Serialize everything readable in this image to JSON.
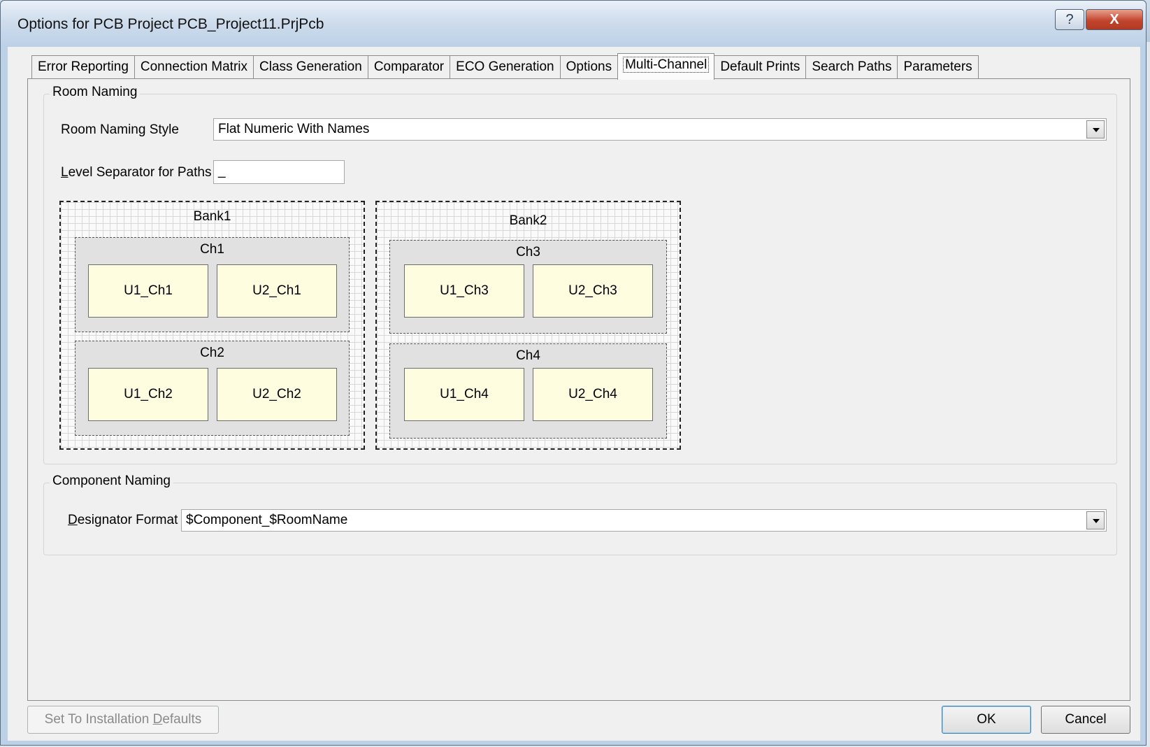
{
  "window": {
    "title": "Options for PCB Project PCB_Project11.PrjPcb",
    "help_glyph": "?",
    "close_glyph": "X"
  },
  "tabs": [
    {
      "label": "Error Reporting"
    },
    {
      "label": "Connection Matrix"
    },
    {
      "label": "Class Generation"
    },
    {
      "label": "Comparator"
    },
    {
      "label": "ECO Generation"
    },
    {
      "label": "Options"
    },
    {
      "label": "Multi-Channel",
      "active": true
    },
    {
      "label": "Default Prints"
    },
    {
      "label": "Search Paths"
    },
    {
      "label": "Parameters"
    }
  ],
  "room_naming": {
    "group_label": "Room Naming",
    "style_label": "Room Naming Style",
    "style_value": "Flat Numeric With Names",
    "separator_label_rest": "evel Separator for Paths",
    "separator_label_key": "L",
    "separator_value": "_"
  },
  "diagram": {
    "banks": [
      {
        "label": "Bank1",
        "channels": [
          {
            "label": "Ch1",
            "components": [
              "U1_Ch1",
              "U2_Ch1"
            ]
          },
          {
            "label": "Ch2",
            "components": [
              "U1_Ch2",
              "U2_Ch2"
            ]
          }
        ]
      },
      {
        "label": "Bank2",
        "channels": [
          {
            "label": "Ch3",
            "components": [
              "U1_Ch3",
              "U2_Ch3"
            ]
          },
          {
            "label": "Ch4",
            "components": [
              "U1_Ch4",
              "U2_Ch4"
            ]
          }
        ]
      }
    ]
  },
  "component_naming": {
    "group_label": "Component Naming",
    "designator_label_key": "D",
    "designator_label_rest": "esignator Format",
    "designator_value": "$Component_$RoomName"
  },
  "buttons": {
    "defaults_pre": "Set To Installation ",
    "defaults_key": "D",
    "defaults_post": "efaults",
    "ok": "OK",
    "cancel": "Cancel"
  },
  "colors": {
    "component_fill": "#fefde0",
    "channel_fill": "#e1e1e1",
    "title_bar": "#bcd0e6",
    "close_button": "#c2452d"
  }
}
